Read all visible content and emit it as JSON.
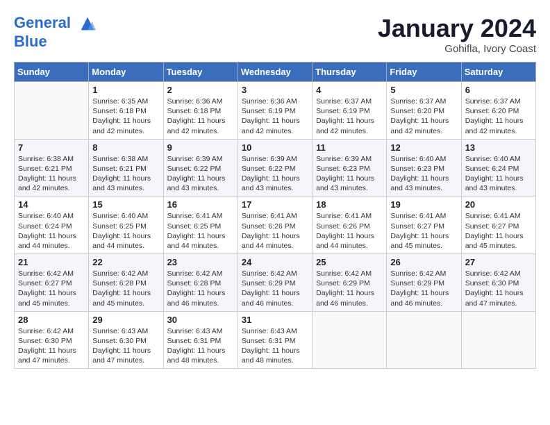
{
  "header": {
    "logo_line1": "General",
    "logo_line2": "Blue",
    "month": "January 2024",
    "location": "Gohifla, Ivory Coast"
  },
  "weekdays": [
    "Sunday",
    "Monday",
    "Tuesday",
    "Wednesday",
    "Thursday",
    "Friday",
    "Saturday"
  ],
  "weeks": [
    [
      {
        "day": "",
        "text": ""
      },
      {
        "day": "1",
        "text": "Sunrise: 6:35 AM\nSunset: 6:18 PM\nDaylight: 11 hours and 42 minutes."
      },
      {
        "day": "2",
        "text": "Sunrise: 6:36 AM\nSunset: 6:18 PM\nDaylight: 11 hours and 42 minutes."
      },
      {
        "day": "3",
        "text": "Sunrise: 6:36 AM\nSunset: 6:19 PM\nDaylight: 11 hours and 42 minutes."
      },
      {
        "day": "4",
        "text": "Sunrise: 6:37 AM\nSunset: 6:19 PM\nDaylight: 11 hours and 42 minutes."
      },
      {
        "day": "5",
        "text": "Sunrise: 6:37 AM\nSunset: 6:20 PM\nDaylight: 11 hours and 42 minutes."
      },
      {
        "day": "6",
        "text": "Sunrise: 6:37 AM\nSunset: 6:20 PM\nDaylight: 11 hours and 42 minutes."
      }
    ],
    [
      {
        "day": "7",
        "text": "Sunrise: 6:38 AM\nSunset: 6:21 PM\nDaylight: 11 hours and 42 minutes."
      },
      {
        "day": "8",
        "text": "Sunrise: 6:38 AM\nSunset: 6:21 PM\nDaylight: 11 hours and 43 minutes."
      },
      {
        "day": "9",
        "text": "Sunrise: 6:39 AM\nSunset: 6:22 PM\nDaylight: 11 hours and 43 minutes."
      },
      {
        "day": "10",
        "text": "Sunrise: 6:39 AM\nSunset: 6:22 PM\nDaylight: 11 hours and 43 minutes."
      },
      {
        "day": "11",
        "text": "Sunrise: 6:39 AM\nSunset: 6:23 PM\nDaylight: 11 hours and 43 minutes."
      },
      {
        "day": "12",
        "text": "Sunrise: 6:40 AM\nSunset: 6:23 PM\nDaylight: 11 hours and 43 minutes."
      },
      {
        "day": "13",
        "text": "Sunrise: 6:40 AM\nSunset: 6:24 PM\nDaylight: 11 hours and 43 minutes."
      }
    ],
    [
      {
        "day": "14",
        "text": "Sunrise: 6:40 AM\nSunset: 6:24 PM\nDaylight: 11 hours and 44 minutes."
      },
      {
        "day": "15",
        "text": "Sunrise: 6:40 AM\nSunset: 6:25 PM\nDaylight: 11 hours and 44 minutes."
      },
      {
        "day": "16",
        "text": "Sunrise: 6:41 AM\nSunset: 6:25 PM\nDaylight: 11 hours and 44 minutes."
      },
      {
        "day": "17",
        "text": "Sunrise: 6:41 AM\nSunset: 6:26 PM\nDaylight: 11 hours and 44 minutes."
      },
      {
        "day": "18",
        "text": "Sunrise: 6:41 AM\nSunset: 6:26 PM\nDaylight: 11 hours and 44 minutes."
      },
      {
        "day": "19",
        "text": "Sunrise: 6:41 AM\nSunset: 6:27 PM\nDaylight: 11 hours and 45 minutes."
      },
      {
        "day": "20",
        "text": "Sunrise: 6:41 AM\nSunset: 6:27 PM\nDaylight: 11 hours and 45 minutes."
      }
    ],
    [
      {
        "day": "21",
        "text": "Sunrise: 6:42 AM\nSunset: 6:27 PM\nDaylight: 11 hours and 45 minutes."
      },
      {
        "day": "22",
        "text": "Sunrise: 6:42 AM\nSunset: 6:28 PM\nDaylight: 11 hours and 45 minutes."
      },
      {
        "day": "23",
        "text": "Sunrise: 6:42 AM\nSunset: 6:28 PM\nDaylight: 11 hours and 46 minutes."
      },
      {
        "day": "24",
        "text": "Sunrise: 6:42 AM\nSunset: 6:29 PM\nDaylight: 11 hours and 46 minutes."
      },
      {
        "day": "25",
        "text": "Sunrise: 6:42 AM\nSunset: 6:29 PM\nDaylight: 11 hours and 46 minutes."
      },
      {
        "day": "26",
        "text": "Sunrise: 6:42 AM\nSunset: 6:29 PM\nDaylight: 11 hours and 46 minutes."
      },
      {
        "day": "27",
        "text": "Sunrise: 6:42 AM\nSunset: 6:30 PM\nDaylight: 11 hours and 47 minutes."
      }
    ],
    [
      {
        "day": "28",
        "text": "Sunrise: 6:42 AM\nSunset: 6:30 PM\nDaylight: 11 hours and 47 minutes."
      },
      {
        "day": "29",
        "text": "Sunrise: 6:43 AM\nSunset: 6:30 PM\nDaylight: 11 hours and 47 minutes."
      },
      {
        "day": "30",
        "text": "Sunrise: 6:43 AM\nSunset: 6:31 PM\nDaylight: 11 hours and 48 minutes."
      },
      {
        "day": "31",
        "text": "Sunrise: 6:43 AM\nSunset: 6:31 PM\nDaylight: 11 hours and 48 minutes."
      },
      {
        "day": "",
        "text": ""
      },
      {
        "day": "",
        "text": ""
      },
      {
        "day": "",
        "text": ""
      }
    ]
  ]
}
